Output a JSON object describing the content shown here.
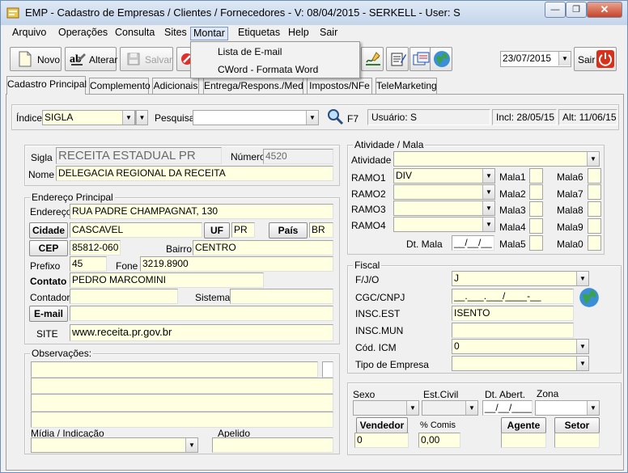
{
  "window": {
    "title": "EMP - Cadastro de Empresas / Clientes / Fornecedores - V: 08/04/2015 - SERKELL - User: S",
    "minimize_glyph": "—",
    "maximize_glyph": "❐",
    "close_glyph": "✕"
  },
  "menu": {
    "items": [
      "Arquivo",
      "Operações",
      "Consulta",
      "Sites",
      "Montar",
      "Etiquetas",
      "Help",
      "Sair"
    ],
    "open_index": 4,
    "dropdown": [
      "Lista de E-mail",
      "CWord - Formata Word"
    ]
  },
  "toolbar": {
    "novo": "Novo",
    "alterar": "Alterar",
    "salvar": "Salvar",
    "date": "23/07/2015",
    "sair": "Sair",
    "icons": [
      "new-document-icon",
      "edit-text-icon",
      "save-disk-icon",
      "cancel-icon",
      "signature-icon",
      "notepad-icon",
      "cards-icon",
      "globe-icon",
      "power-icon"
    ]
  },
  "tabs": [
    "Cadastro Principal",
    "Complemento",
    "Adicionais",
    "Entrega/Respons./Med",
    "Impostos/NFe",
    "TeleMarketing"
  ],
  "search": {
    "indice_label": "Índice",
    "indice_value": "SIGLA",
    "pesquisa_label": "Pesquisa",
    "pesquisa_value": "",
    "f7": "F7",
    "usuario": "Usuário: S",
    "incl": "Incl: 28/05/15",
    "alt": "Alt: 11/06/15"
  },
  "identificacao": {
    "sigla_label": "Sigla",
    "sigla": "RECEITA ESTADUAL PR",
    "numero_label": "Número",
    "numero": "4520",
    "nome_label": "Nome",
    "nome": "DELEGACIA REGIONAL DA RECEITA"
  },
  "endereco": {
    "group": "Endereço Principal",
    "endereco_label": "Endereço",
    "endereco": "RUA PADRE CHAMPAGNAT, 130",
    "cidade_btn": "Cidade",
    "cidade": "CASCAVEL",
    "uf_btn": "UF",
    "uf": "PR",
    "pais_btn": "País",
    "pais": "BR",
    "cep_btn": "CEP",
    "cep": "85812-060",
    "bairro_label": "Bairro",
    "bairro": "CENTRO",
    "prefixo_label": "Prefixo",
    "prefixo": "45",
    "fone_label": "Fone",
    "fone": "3219.8900",
    "contato_label": "Contato",
    "contato": "PEDRO MARCOMINI",
    "contador_label": "Contador",
    "contador": "",
    "sistema_label": "Sistema",
    "sistema": "",
    "email_btn": "E-mail",
    "email": "",
    "site_label": "SITE",
    "site": "www.receita.pr.gov.br"
  },
  "observacoes": {
    "group": "Observações:",
    "midia_label": "Mídia / Indicação",
    "midia": "",
    "apelido_label": "Apelido",
    "apelido": ""
  },
  "atividade": {
    "group": "Atividade / Mala",
    "atividade_label": "Atividade",
    "atividade": "",
    "ramos": [
      {
        "label": "RAMO1",
        "value": "DIV"
      },
      {
        "label": "RAMO2",
        "value": ""
      },
      {
        "label": "RAMO3",
        "value": ""
      },
      {
        "label": "RAMO4",
        "value": ""
      }
    ],
    "malas_left": [
      "Mala1",
      "Mala2",
      "Mala3",
      "Mala4",
      "Mala5"
    ],
    "malas_right": [
      "Mala6",
      "Mala7",
      "Mala8",
      "Mala9",
      "Mala0"
    ],
    "dt_mala_label": "Dt. Mala",
    "dt_mala": "__/__/__"
  },
  "fiscal": {
    "group": "Fiscal",
    "fjo_label": "F/J/O",
    "fjo": "J",
    "cgc_label": "CGC/CNPJ",
    "cgc": "__.___.___/____-__",
    "insc_est_label": "INSC.EST",
    "insc_est": "ISENTO",
    "insc_mun_label": "INSC.MUN",
    "insc_mun": "",
    "icm_label": "Cód. ICM",
    "icm": "0",
    "tipo_label": "Tipo de Empresa",
    "tipo": ""
  },
  "extra": {
    "sexo_label": "Sexo",
    "estcivil_label": "Est.Civil",
    "dtabert_label": "Dt. Abert.",
    "dtabert": "__/__/____",
    "zona_label": "Zona",
    "vendedor_btn": "Vendedor",
    "vendedor": "0",
    "comis_label": "% Comis",
    "comis": "0,00",
    "agente_btn": "Agente",
    "agente": "",
    "setor_btn": "Setor",
    "setor": ""
  },
  "colors": {
    "field_yellow": "#ffffe1",
    "accent_red": "#d9301c"
  }
}
